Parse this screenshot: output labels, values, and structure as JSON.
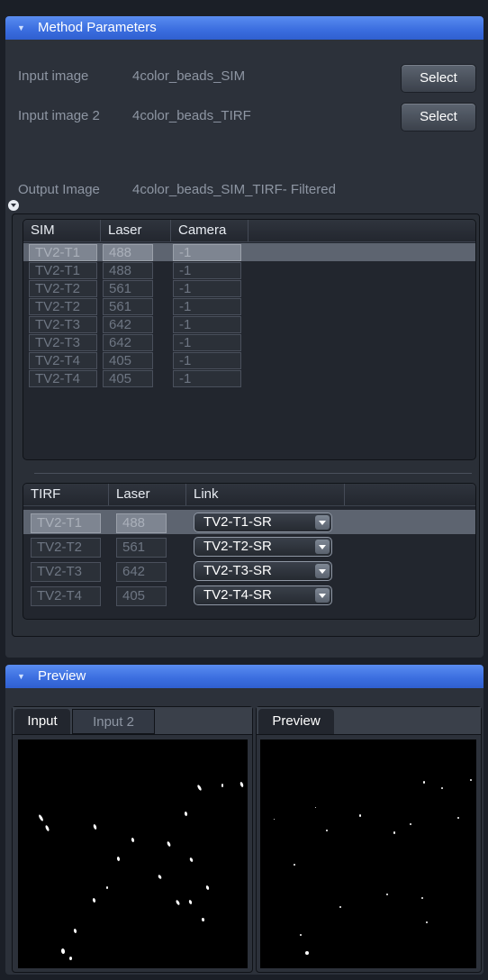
{
  "method": {
    "title": "Method Parameters",
    "input_label": "Input image",
    "input_value": "4color_beads_SIM",
    "input2_label": "Input image 2",
    "input2_value": "4color_beads_TIRF",
    "select_label": "Select",
    "output_label": "Output Image",
    "output_value": "4color_beads_SIM_TIRF- Filtered"
  },
  "sim_table": {
    "headers": [
      "SIM",
      "Laser",
      "Camera"
    ],
    "rows": [
      {
        "name": "TV2-T1",
        "laser": "488",
        "camera": "-1"
      },
      {
        "name": "TV2-T1",
        "laser": "488",
        "camera": "-1"
      },
      {
        "name": "TV2-T2",
        "laser": "561",
        "camera": "-1"
      },
      {
        "name": "TV2-T2",
        "laser": "561",
        "camera": "-1"
      },
      {
        "name": "TV2-T3",
        "laser": "642",
        "camera": "-1"
      },
      {
        "name": "TV2-T3",
        "laser": "642",
        "camera": "-1"
      },
      {
        "name": "TV2-T4",
        "laser": "405",
        "camera": "-1"
      },
      {
        "name": "TV2-T4",
        "laser": "405",
        "camera": "-1"
      }
    ]
  },
  "tirf_table": {
    "headers": [
      "TIRF",
      "Laser",
      "Link"
    ],
    "rows": [
      {
        "name": "TV2-T1",
        "laser": "488",
        "link": "TV2-T1-SR"
      },
      {
        "name": "TV2-T2",
        "laser": "561",
        "link": "TV2-T2-SR"
      },
      {
        "name": "TV2-T3",
        "laser": "642",
        "link": "TV2-T3-SR"
      },
      {
        "name": "TV2-T4",
        "laser": "405",
        "link": "TV2-T4-SR"
      }
    ]
  },
  "preview": {
    "title": "Preview",
    "left_tabs": [
      "Input",
      "Input 2"
    ],
    "right_tabs": [
      "Preview"
    ]
  }
}
